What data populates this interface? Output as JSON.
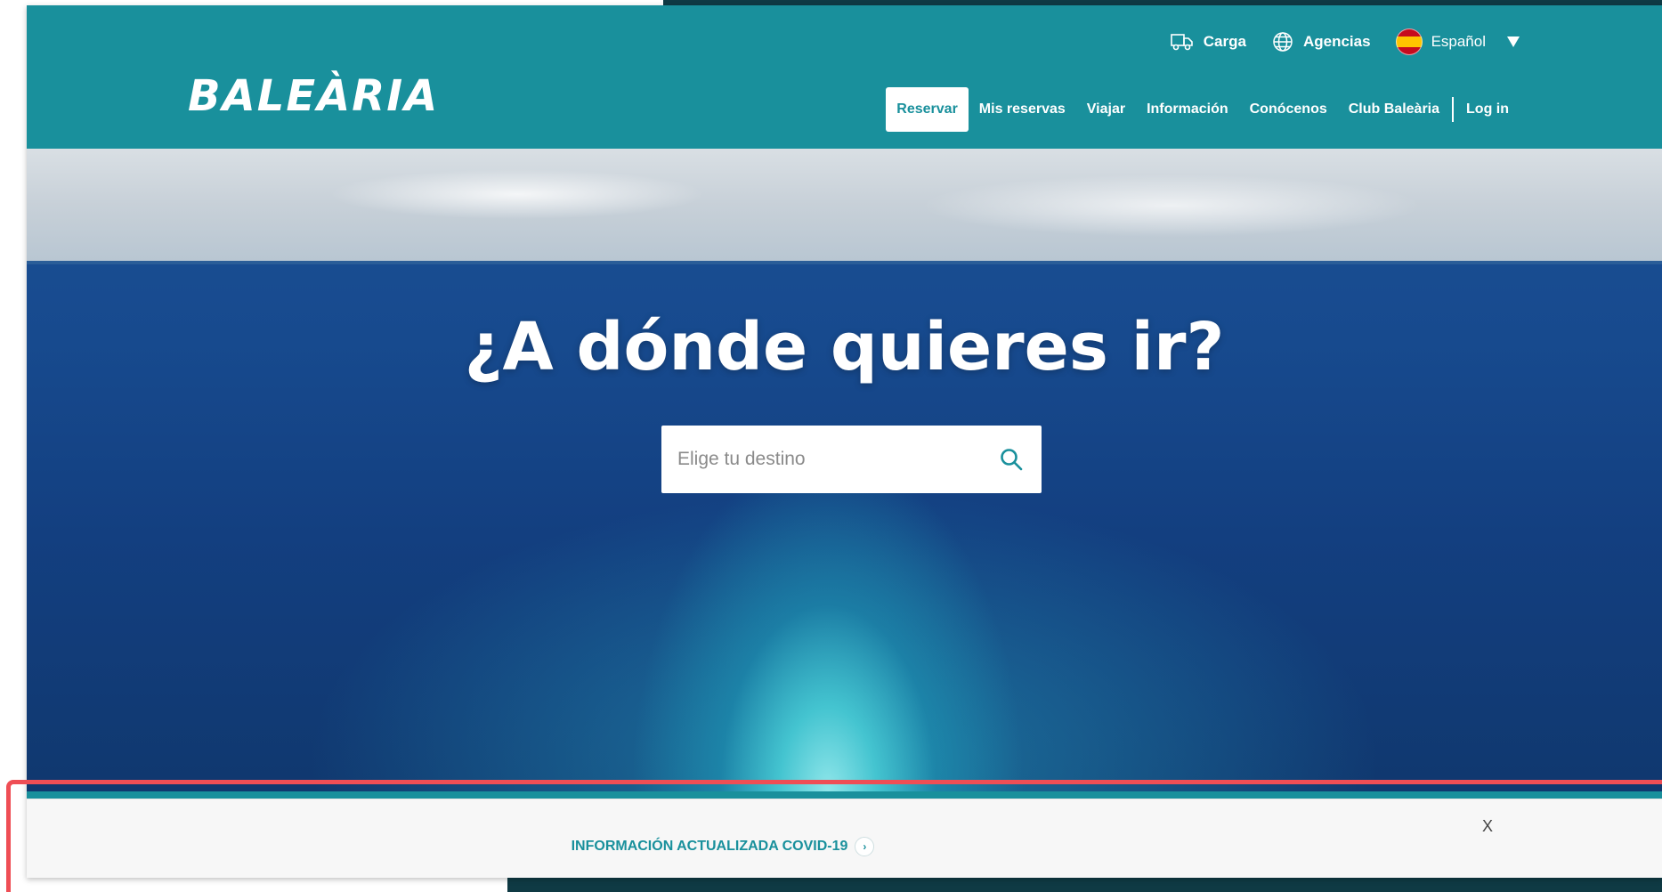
{
  "header": {
    "logo": "BALEÀRIA",
    "utility": {
      "cargo_label": "Carga",
      "agencies_label": "Agencias",
      "language_label": "Español"
    },
    "nav": [
      {
        "label": "Reservar",
        "active": true
      },
      {
        "label": "Mis reservas"
      },
      {
        "label": "Viajar"
      },
      {
        "label": "Información"
      },
      {
        "label": "Conócenos"
      },
      {
        "label": "Club Baleària"
      }
    ],
    "login_label": "Log in"
  },
  "hero": {
    "title": "¿A dónde quieres ir?",
    "search_placeholder": "Elige tu destino"
  },
  "banner": {
    "link_label": "INFORMACIÓN ACTUALIZADA COVID-19",
    "close_label": "X"
  },
  "colors": {
    "brand": "#19909c",
    "highlight": "#ef4e55"
  },
  "icons": [
    "truck-icon",
    "globe-icon",
    "spain-flag-icon",
    "caret-down-icon",
    "search-icon",
    "chevron-right-icon"
  ]
}
